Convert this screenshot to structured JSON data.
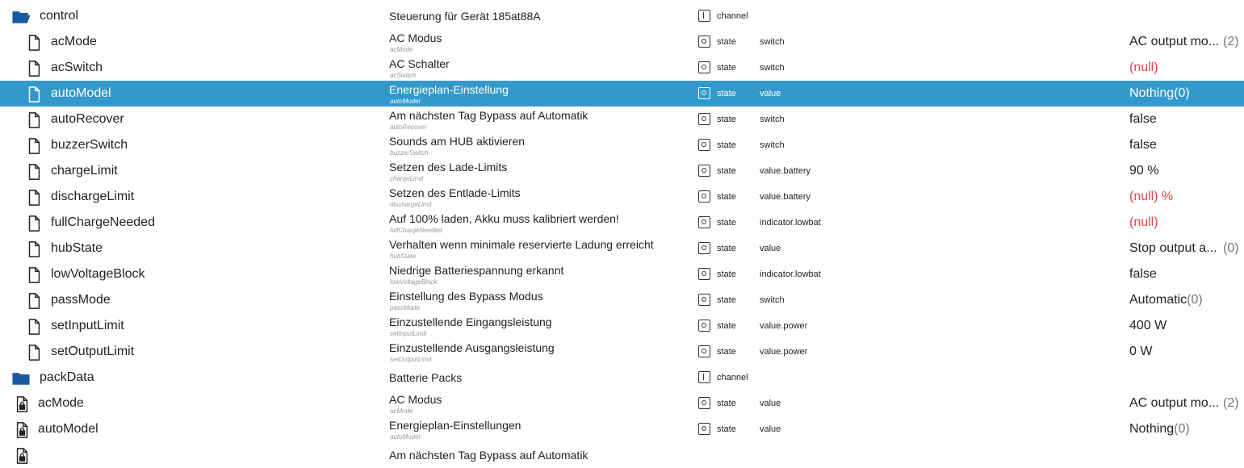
{
  "colors": {
    "selected_bg": "#3399cc",
    "folder": "#1a5aa0",
    "null_value": "#e04545"
  },
  "rows": [
    {
      "kind": "folder-open",
      "name": "control",
      "desc": "Steuerung für Gerät 185at88A",
      "desc_sub": "",
      "type": "channel",
      "role": "",
      "value": "",
      "value_extra": ""
    },
    {
      "kind": "file",
      "name": "acMode",
      "desc": "AC Modus",
      "desc_sub": "acMode",
      "type": "state",
      "role": "switch",
      "value": "AC output mo...",
      "value_extra": "(2)"
    },
    {
      "kind": "file",
      "name": "acSwitch",
      "desc": "AC Schalter",
      "desc_sub": "acSwitch",
      "type": "state",
      "role": "switch",
      "value": "(null)",
      "value_extra": ""
    },
    {
      "kind": "file",
      "name": "autoModel",
      "desc": "Energieplan-Einstellung",
      "desc_sub": "autoModel",
      "type": "state",
      "role": "value",
      "value": "Nothing",
      "value_inline": "(0)"
    },
    {
      "kind": "file",
      "name": "autoRecover",
      "desc": "Am nächsten Tag Bypass auf Automatik",
      "desc_sub": "autoRecover",
      "type": "state",
      "role": "switch",
      "value": "false",
      "value_extra": ""
    },
    {
      "kind": "file",
      "name": "buzzerSwitch",
      "desc": "Sounds am HUB aktivieren",
      "desc_sub": "buzzerSwitch",
      "type": "state",
      "role": "switch",
      "value": "false",
      "value_extra": ""
    },
    {
      "kind": "file",
      "name": "chargeLimit",
      "desc": "Setzen des Lade-Limits",
      "desc_sub": "chargeLimit",
      "type": "state",
      "role": "value.battery",
      "value": "90 %",
      "value_extra": ""
    },
    {
      "kind": "file",
      "name": "dischargeLimit",
      "desc": "Setzen des Entlade-Limits",
      "desc_sub": "dischargeLimit",
      "type": "state",
      "role": "value.battery",
      "value": "(null) %",
      "value_extra": ""
    },
    {
      "kind": "file",
      "name": "fullChargeNeeded",
      "desc": "Auf 100% laden, Akku muss kalibriert werden!",
      "desc_sub": "fullChargeNeeded",
      "type": "state",
      "role": "indicator.lowbat",
      "value": "(null)",
      "value_extra": ""
    },
    {
      "kind": "file",
      "name": "hubState",
      "desc": "Verhalten wenn minimale reservierte Ladung erreicht",
      "desc_sub": "hubState",
      "type": "state",
      "role": "value",
      "value": "Stop output a...",
      "value_extra": "(0)"
    },
    {
      "kind": "file",
      "name": "lowVoltageBlock",
      "desc": "Niedrige Batteriespannung erkannt",
      "desc_sub": "lowVoltageBlock",
      "type": "state",
      "role": "indicator.lowbat",
      "value": "false",
      "value_extra": ""
    },
    {
      "kind": "file",
      "name": "passMode",
      "desc": "Einstellung des Bypass Modus",
      "desc_sub": "passMode",
      "type": "state",
      "role": "switch",
      "value": "Automatic",
      "value_inline": "(0)"
    },
    {
      "kind": "file",
      "name": "setInputLimit",
      "desc": "Einzustellende Eingangsleistung",
      "desc_sub": "setInputLimit",
      "type": "state",
      "role": "value.power",
      "value": "400 W",
      "value_extra": ""
    },
    {
      "kind": "file",
      "name": "setOutputLimit",
      "desc": "Einzustellende Ausgangsleistung",
      "desc_sub": "setOutputLimit",
      "type": "state",
      "role": "value.power",
      "value": "0 W",
      "value_extra": ""
    },
    {
      "kind": "folder",
      "name": "packData",
      "desc": "Batterie Packs",
      "desc_sub": "",
      "type": "channel",
      "role": "",
      "value": "",
      "value_extra": ""
    },
    {
      "kind": "file-lock",
      "name": "acMode",
      "desc": "AC Modus",
      "desc_sub": "acMode",
      "type": "state",
      "role": "value",
      "value": "AC output mo...",
      "value_extra": "(2)"
    },
    {
      "kind": "file-lock",
      "name": "autoModel",
      "desc": "Energieplan-Einstellungen",
      "desc_sub": "autoModel",
      "type": "state",
      "role": "value",
      "value": "Nothing",
      "value_inline": "(0)"
    },
    {
      "kind": "file-lock",
      "name": "",
      "desc": "Am nächsten Tag Bypass auf Automatik",
      "desc_sub": "",
      "type": "",
      "role": "",
      "value": "",
      "value_extra": ""
    }
  ]
}
